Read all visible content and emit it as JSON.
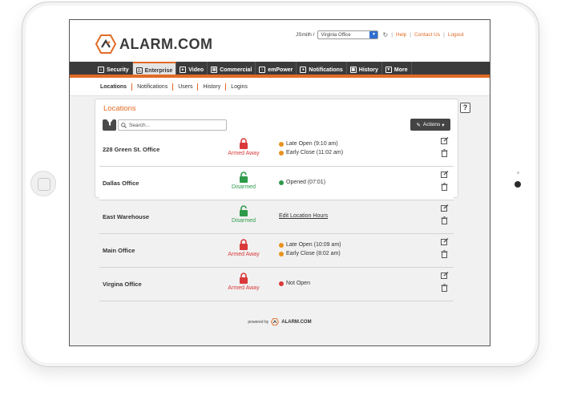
{
  "brand": {
    "name": "ALARM.COM",
    "accent": "#e26b27"
  },
  "header": {
    "user": "JSmith /",
    "location_selected": "Virginia Office",
    "links": [
      "Help",
      "Contact Us",
      "Logout"
    ]
  },
  "nav": {
    "tabs": [
      {
        "label": "Security",
        "icon": "home-icon"
      },
      {
        "label": "Enterprise",
        "icon": "enterprise-icon",
        "active": true
      },
      {
        "label": "Video",
        "icon": "video-icon"
      },
      {
        "label": "Commercial",
        "icon": "building-icon"
      },
      {
        "label": "emPower",
        "icon": "bulb-icon"
      },
      {
        "label": "Notifications",
        "icon": "chat-icon"
      },
      {
        "label": "History",
        "icon": "calendar-icon"
      },
      {
        "label": "More",
        "icon": "caret-down-icon"
      }
    ]
  },
  "subnav": {
    "items": [
      "Locations",
      "Notifications",
      "Users",
      "History",
      "Logins"
    ]
  },
  "panel": {
    "title": "Locations",
    "help": "?",
    "search_placeholder": "Search...",
    "actions_label": "Actions"
  },
  "locations": [
    {
      "name": "228 Green St. Office",
      "status": "Armed Away",
      "armed": true,
      "events": [
        {
          "text": "Late Open (9:10 am)",
          "type": "warning"
        },
        {
          "text": "Early Close (11:02 am)",
          "type": "warning"
        }
      ]
    },
    {
      "name": "Dallas Office",
      "status": "Disarmed",
      "armed": false,
      "events": [
        {
          "text": "Opened (07:01)",
          "type": "ok"
        }
      ]
    },
    {
      "name": "East Warehouse",
      "status": "Disarmed",
      "armed": false,
      "events": [
        {
          "text": "Edit Location Hours",
          "type": "link"
        }
      ]
    },
    {
      "name": "Main Office",
      "status": "Armed Away",
      "armed": true,
      "events": [
        {
          "text": "Late Open (10:09 am)",
          "type": "warning"
        },
        {
          "text": "Early Close (8:02 am)",
          "type": "warning"
        }
      ]
    },
    {
      "name": "Virgina Office",
      "status": "Armed Away",
      "armed": true,
      "events": [
        {
          "text": "Not Open",
          "type": "alert"
        }
      ]
    }
  ],
  "footer": {
    "powered_by": "powered by",
    "logo": "ALARM.COM"
  },
  "colors": {
    "armed": "#d9393a",
    "disarmed": "#2e9a4a",
    "warning": "#e8921e",
    "alert": "#d9393a",
    "ok": "#2e9a4a"
  }
}
